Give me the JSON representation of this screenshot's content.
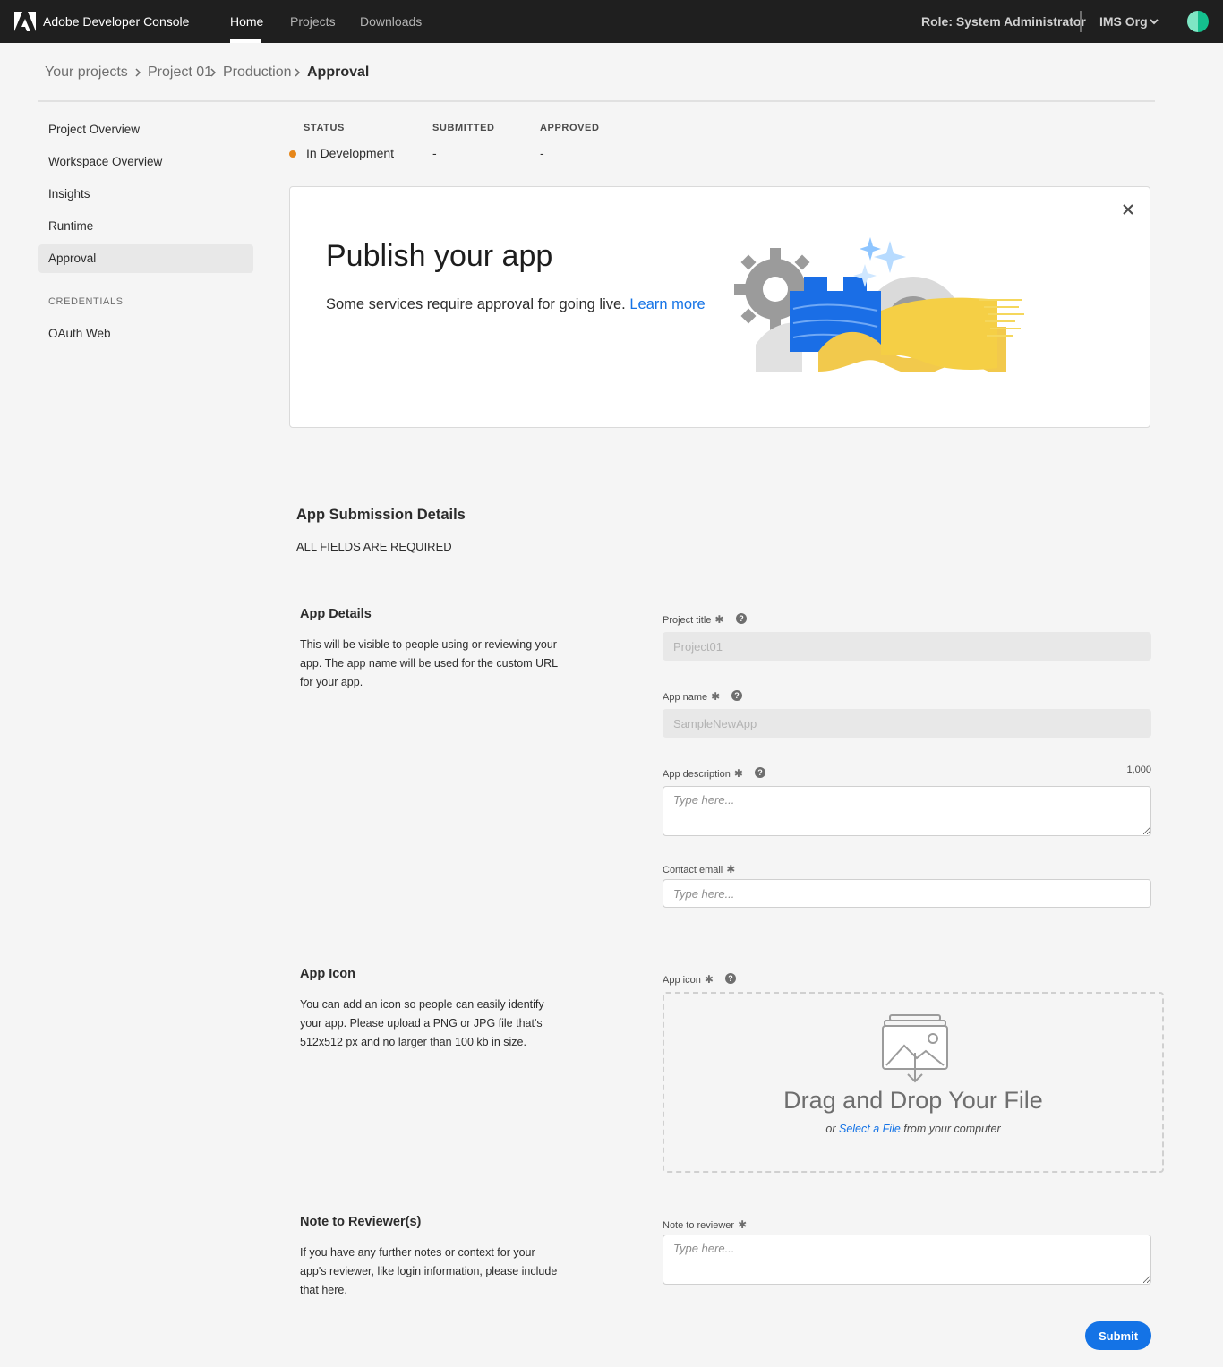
{
  "topbar": {
    "brand": "Adobe Developer Console",
    "nav": [
      "Home",
      "Projects",
      "Downloads"
    ],
    "role": "Role: System Administrator",
    "org": "IMS Org"
  },
  "breadcrumb": [
    "Your projects",
    "Project 01",
    "Production",
    "Approval"
  ],
  "sidebar": {
    "items": [
      "Project Overview",
      "Workspace Overview",
      "Insights",
      "Runtime",
      "Approval"
    ],
    "section": "CREDENTIALS",
    "credentials": [
      "OAuth Web"
    ]
  },
  "status": {
    "headers": [
      "STATUS",
      "SUBMITTED",
      "APPROVED"
    ],
    "values": [
      "In Development",
      "-",
      "-"
    ],
    "status_color": "#e68619"
  },
  "publish_card": {
    "title": "Publish your app",
    "subtitle": "Some services require approval for going live.",
    "link": "Learn more"
  },
  "submission": {
    "heading": "App Submission Details",
    "required_note": "ALL FIELDS ARE REQUIRED"
  },
  "app_details": {
    "title": "App Details",
    "description": "This will be visible to people using or reviewing your app. The app name will be used for the custom URL for your app.",
    "project_title_label": "Project title",
    "project_title_value": "Project01",
    "app_name_label": "App name",
    "app_name_value": "SampleNewApp",
    "app_description_label": "App description",
    "app_description_counter": "1,000",
    "app_description_placeholder": "Type here...",
    "contact_email_label": "Contact email",
    "contact_email_placeholder": "Type here..."
  },
  "app_icon": {
    "title": "App Icon",
    "description": "You can add an icon so people can easily identify your app. Please upload a PNG or JPG file that's 512x512 px and no larger than 100 kb in size.",
    "label": "App icon",
    "drop_title": "Drag and Drop Your File",
    "drop_or": "or",
    "drop_link": "Select a File",
    "drop_suffix": "from your computer"
  },
  "note": {
    "title": "Note to Reviewer(s)",
    "description": "If you have any further notes or context for your app's reviewer, like login information, please include that here.",
    "label": "Note to reviewer",
    "placeholder": "Type here..."
  },
  "required_mark": "✱",
  "help_mark": "?",
  "submit_label": "Submit",
  "colors": {
    "accent": "#1473e6",
    "topbar": "#1f1f1f",
    "status_dot": "#e68619"
  }
}
